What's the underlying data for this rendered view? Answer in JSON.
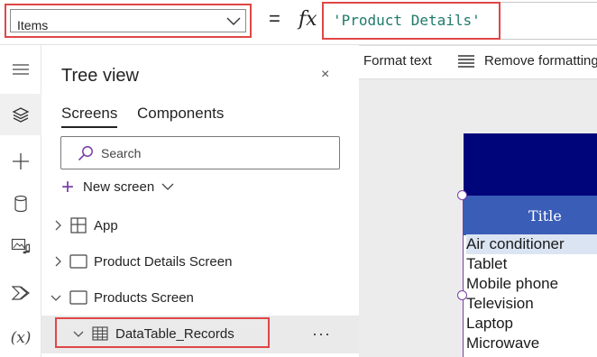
{
  "formula_bar": {
    "property_value": "Items",
    "equals": "=",
    "fx": "fx",
    "formula": "'Product Details'"
  },
  "format_toolbar": {
    "format_text": "Format text",
    "remove_formatting": "Remove formatting"
  },
  "tree_view": {
    "title": "Tree view",
    "close": "×",
    "tabs": [
      {
        "label": "Screens",
        "active": true
      },
      {
        "label": "Components",
        "active": false
      }
    ],
    "search_placeholder": "Search",
    "new_screen_label": "New screen",
    "items": [
      {
        "label": "App",
        "icon": "app-icon",
        "expanded": false
      },
      {
        "label": "Product Details Screen",
        "icon": "screen-icon",
        "expanded": false
      },
      {
        "label": "Products Screen",
        "icon": "screen-icon",
        "expanded": true
      },
      {
        "label": "DataTable_Records",
        "icon": "table-icon",
        "expanded": true,
        "selected": true
      }
    ],
    "more": "···"
  },
  "left_rail": [
    {
      "icon": "hamburger-menu-icon"
    },
    {
      "icon": "layers-icon",
      "active": true
    },
    {
      "icon": "plus-icon"
    },
    {
      "icon": "database-icon"
    },
    {
      "icon": "media-icon"
    },
    {
      "icon": "power-automate-icon"
    },
    {
      "icon": "variables-icon",
      "text": "(x)"
    }
  ],
  "canvas": {
    "table_header": "Title",
    "rows": [
      "Air conditioner",
      "Tablet",
      "Mobile phone",
      "Television",
      "Laptop",
      "Microwave"
    ],
    "selected_row": 0
  },
  "colors": {
    "highlight": "#e04646",
    "accent": "#7a3ea8",
    "header_dark": "#00057a",
    "table_header": "#3a5db8",
    "formula_text": "#1f7a6a"
  }
}
